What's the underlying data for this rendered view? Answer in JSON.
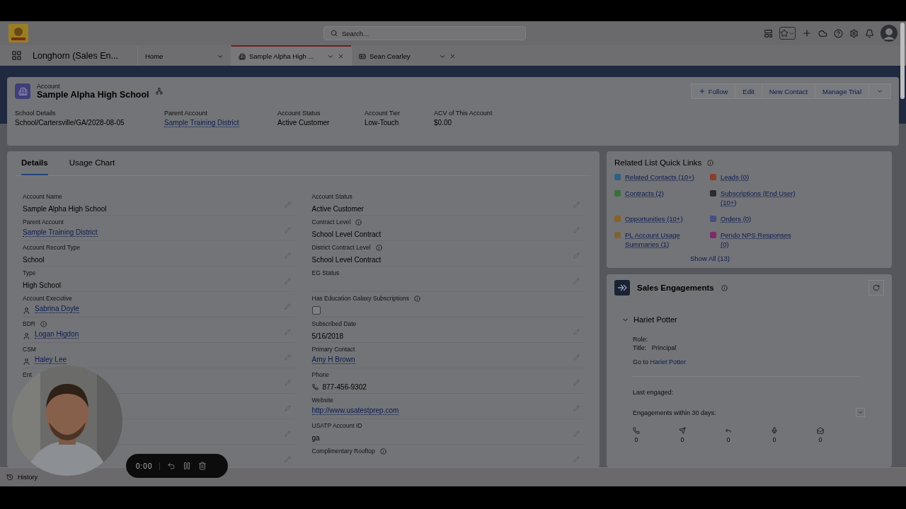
{
  "app": {
    "name": "Longhorn (Sales En..."
  },
  "search": {
    "placeholder": "Search..."
  },
  "nav_tabs": [
    {
      "label": "Home",
      "selected": false,
      "closable": false,
      "kind": "home"
    },
    {
      "label": "Sample Alpha High ...",
      "selected": true,
      "closable": true,
      "kind": "account"
    },
    {
      "label": "Sean Cearley",
      "selected": false,
      "closable": true,
      "kind": "contact"
    }
  ],
  "record": {
    "type": "Account",
    "title": "Sample Alpha High School",
    "actions": [
      "Follow",
      "Edit",
      "New Contact",
      "Manage Trial"
    ]
  },
  "highlights": [
    {
      "label": "School Details",
      "value": "School/Cartersville/GA/2028-08-05",
      "kind": "text"
    },
    {
      "label": "Parent Account",
      "value": "Sample Training District",
      "kind": "link"
    },
    {
      "label": "Account Status",
      "value": "Active Customer",
      "kind": "text"
    },
    {
      "label": "Account Tier",
      "value": "Low-Touch",
      "kind": "text"
    },
    {
      "label": "ACV of This Account",
      "value": "$0.00",
      "kind": "text"
    }
  ],
  "detail_tabs": [
    {
      "label": "Details",
      "selected": true
    },
    {
      "label": "Usage Chart",
      "selected": false
    }
  ],
  "left_fields": [
    {
      "label": "Account Name",
      "value": "Sample Alpha High School",
      "kind": "text",
      "info": false
    },
    {
      "label": "Parent Account",
      "value": "Sample Training District",
      "kind": "link",
      "info": false
    },
    {
      "label": "Account Record Type",
      "value": "School",
      "kind": "text",
      "info": false
    },
    {
      "label": "Type",
      "value": "High School",
      "kind": "text",
      "info": false
    },
    {
      "label": "Account Executive",
      "value": "Sabrina Doyle",
      "kind": "user",
      "info": false
    },
    {
      "label": "BDR",
      "value": "Logan Higdon",
      "kind": "user",
      "info": true
    },
    {
      "label": "CSM",
      "value": "Haley Lee",
      "kind": "user",
      "info": false
    },
    {
      "label": "Ent",
      "kind": "text",
      "info": false
    },
    {
      "kind": "blank"
    },
    {
      "kind": "blank"
    },
    {
      "kind": "blank"
    }
  ],
  "right_fields": [
    {
      "label": "Account Status",
      "value": "Active Customer",
      "kind": "text",
      "info": false
    },
    {
      "label": "Contract Level",
      "value": "School Level Contract",
      "kind": "text",
      "info": true
    },
    {
      "label": "District Contract Level",
      "value": "School Level Contract",
      "kind": "text",
      "info": true
    },
    {
      "label": "EG Status",
      "kind": "text",
      "info": false
    },
    {
      "label": "Has Education Galaxy Subscriptions",
      "kind": "checkbox",
      "checked": false,
      "info": true
    },
    {
      "label": "Subscribed Date",
      "value": "5/16/2018",
      "kind": "text",
      "info": false
    },
    {
      "label": "Primary Contact",
      "value": "Amy H Brown",
      "kind": "link",
      "info": false
    },
    {
      "label": "Phone",
      "value": "877-456-9302",
      "kind": "phone",
      "info": false
    },
    {
      "label": "Website",
      "value": "http://www.usatestprep.com",
      "kind": "link",
      "info": false
    },
    {
      "label": "USATP Account ID",
      "value": "ga",
      "kind": "text",
      "info": false
    },
    {
      "label": "Complimentary Rooftop",
      "kind": "text",
      "info": true
    }
  ],
  "quick_links": {
    "title": "Related List Quick Links",
    "items": [
      {
        "label": "Related Contacts (10+)",
        "color": "#2f5f86"
      },
      {
        "label": "Leads (0)",
        "color": "#8a3f2c"
      },
      {
        "label": "Contracts (2)",
        "color": "#3b6f36"
      },
      {
        "label": "Subscriptions (End User) (10+)",
        "color": "#2c2c30"
      },
      {
        "label": "Opportunities (10+)",
        "color": "#86622a"
      },
      {
        "label": "Orders (0)",
        "color": "#45507e"
      },
      {
        "label": "PL Account Usage Summaries (1)",
        "color": "#7f6238"
      },
      {
        "label": "Pendo NPS Responses (0)",
        "color": "#7e2a6a"
      }
    ],
    "show_all": "Show All (13)"
  },
  "engagements": {
    "title": "Sales Engagements",
    "contact": {
      "name": "Hariet Potter",
      "expanded": true
    },
    "role_label": "Role:",
    "title_label": "Title:",
    "title_value": "Principal",
    "goto_prefix": "Go to",
    "goto_link": "Hariet Potter",
    "last_engaged": "Last engaged:",
    "within": "Engagements within 30 days:",
    "counts": [
      {
        "kind": "call",
        "value": "0"
      },
      {
        "kind": "email",
        "value": "0"
      },
      {
        "kind": "reply",
        "value": "0"
      },
      {
        "kind": "voicemail",
        "value": "0"
      },
      {
        "kind": "opened",
        "value": "0"
      }
    ]
  },
  "recorder": {
    "time": "0:00"
  },
  "utility": {
    "label": "History"
  }
}
